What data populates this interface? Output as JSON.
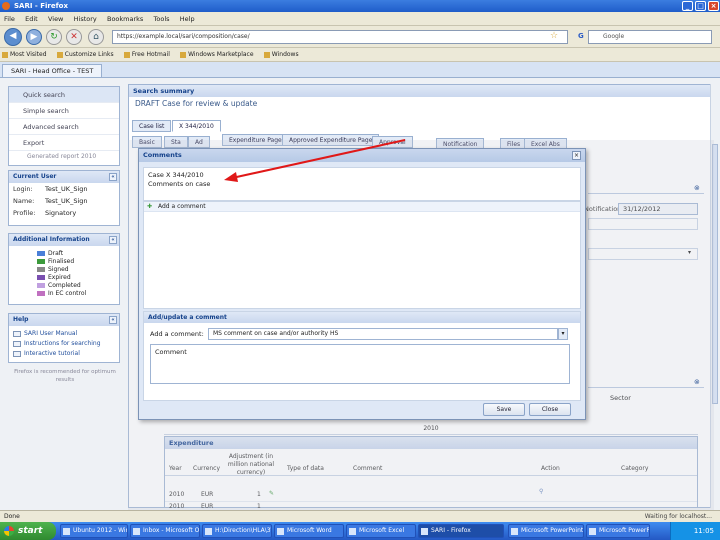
{
  "window": {
    "title": "SARI - Firefox"
  },
  "menu": [
    "File",
    "Edit",
    "View",
    "History",
    "Bookmarks",
    "Tools",
    "Help"
  ],
  "nav": {
    "url": "https://example.local/sari/composition/case/",
    "search_placeholder": "Google"
  },
  "bookmarks": [
    "Most Visited",
    "Customize Links",
    "Free Hotmail",
    "Windows Marketplace",
    "Windows"
  ],
  "page_tab": "SARI - Head Office - TEST",
  "sidebar": {
    "nav_items": [
      "Quick search",
      "Simple search",
      "Advanced search",
      "Export"
    ],
    "nav_note": "Generated report 2010",
    "user_title": "Current User",
    "user": {
      "login_label": "Login:",
      "login": "Test_UK_Sign",
      "name_label": "Name:",
      "name": "Test_UK_Sign",
      "profile_label": "Profile:",
      "profile": "Signatory"
    },
    "info_title": "Additional Information",
    "legend": [
      {
        "label": "Draft",
        "color": "#4a7fd8"
      },
      {
        "label": "Finalised",
        "color": "#3c9a3c"
      },
      {
        "label": "Signed",
        "color": "#888888"
      },
      {
        "label": "Expired",
        "color": "#7a4fb0"
      },
      {
        "label": "Completed",
        "color": "#c0a0e0"
      },
      {
        "label": "In EC control",
        "color": "#c070c0"
      }
    ],
    "help_title": "Help",
    "help_links": [
      "SARI User Manual",
      "Instructions for searching",
      "Interactive tutorial"
    ],
    "help_note": "Firefox is recommended for optimum results"
  },
  "main": {
    "search_title": "Search summary",
    "case_heading": "DRAFT Case for review & update",
    "tabs": [
      "Case list",
      "X 344/2010"
    ],
    "subtabs": [
      "Basic",
      "Sta",
      "Ad",
      "Expenditure Page",
      "Approved Expenditure Page",
      "Approval",
      "Notification",
      "Files",
      "Excel Abs"
    ],
    "date_label": "Notification end:",
    "date_value": "31/12/2012"
  },
  "modal": {
    "title": "Comments",
    "case_line": "Case X 344/2010",
    "comments_line": "Comments on case",
    "add_link": "Add a comment",
    "section_title": "Add/update a comment",
    "add_label": "Add a comment:",
    "select_value": "MS comment on case and/or authority HS",
    "textarea_value": "Comment",
    "save_label": "Save",
    "close_label": "Close"
  },
  "lower": {
    "sector_label": "Sector",
    "year_label": "2010",
    "expenditure_title": "Expenditure",
    "columns": [
      "Year",
      "Currency",
      "Adjustment (in million national currency)",
      "Type of data",
      "Comment",
      "Action",
      "Category"
    ],
    "rows": [
      {
        "year": "2010",
        "currency": "EUR",
        "amount": "1"
      },
      {
        "year": "2010",
        "currency": "EUR",
        "amount": "1"
      }
    ]
  },
  "status": {
    "left": "Done",
    "right": "Waiting for localhost..."
  },
  "taskbar": {
    "start_label": "start",
    "buttons": [
      "Ubuntu 2012 - Window...",
      "Inbox - Microsoft Ou...",
      "H:\\Direction\\HLA\\3\\...",
      "Microsoft Word",
      "Microsoft Excel",
      "SARI - Firefox",
      "Microsoft PowerPoint"
    ],
    "clock": "11:05"
  }
}
